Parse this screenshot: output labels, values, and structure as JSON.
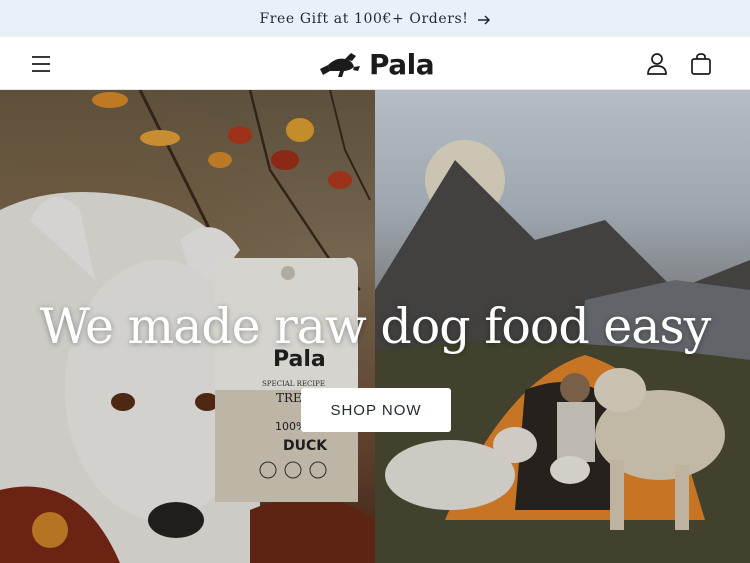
{
  "announcement": {
    "text": "Free Gift at 100€+ Orders!",
    "arrow_icon": "arrow-right-icon"
  },
  "header": {
    "menu_icon": "hamburger-menu-icon",
    "brand": "Pala",
    "account_icon": "user-icon",
    "cart_icon": "shopping-bag-icon"
  },
  "hero": {
    "headline": "We made raw dog food easy",
    "cta_label": "SHOP NOW",
    "left_image": "white dog lying in autumn leaves with Pala duck treats bag",
    "right_image": "dogs beside orange tent in mountain valley at sunrise",
    "product_bag": {
      "brand": "Pala",
      "line1": "SPECIAL RECIPE",
      "line2": "TRE",
      "line3": "100%",
      "flavor": "DUCK"
    }
  },
  "colors": {
    "announce_bg": "#e9f1f8",
    "text_dark": "#1c2a33",
    "button_bg": "#ffffff"
  }
}
